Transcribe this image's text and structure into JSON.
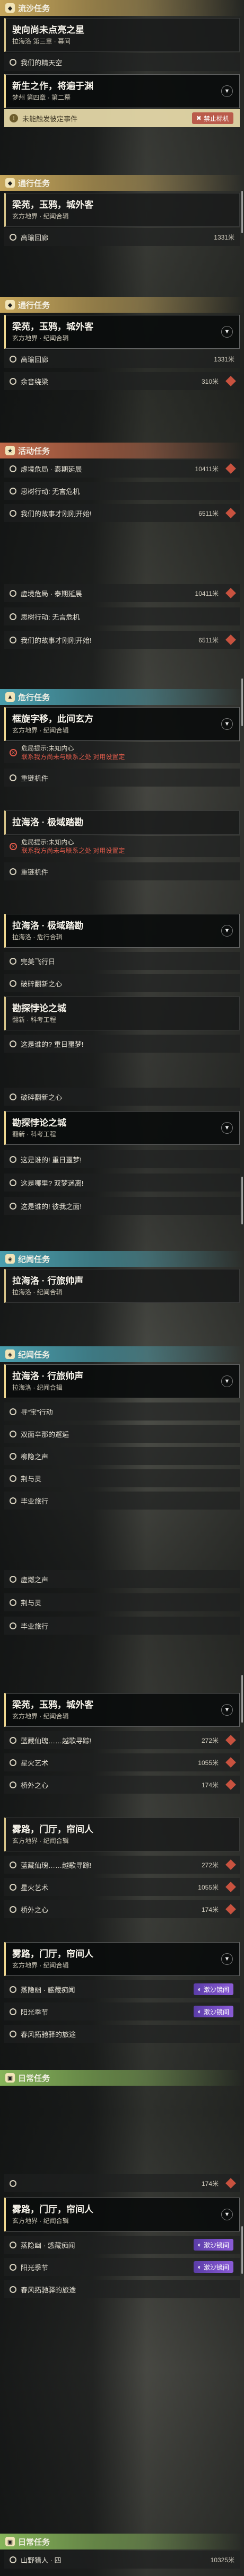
{
  "categories": {
    "main": "流沙任务",
    "main2": "通行任务",
    "activity": "活动任务",
    "hidden": "危行任务",
    "region": "纪闻任务",
    "daily": "日常任务"
  },
  "badges": {
    "locked": "禁止标机",
    "tracked": "漱沙镜间"
  },
  "s1": {
    "card1": {
      "title": "驶向尚未点亮之星",
      "sub": "拉海洛 第三章 · 幕间"
    },
    "row1": "我们的精天空",
    "card2": {
      "title": "新生之作，将遍于渊",
      "sub": "梦州 第四章 · 第二幕"
    },
    "banner": "未能触发彼定事件"
  },
  "s2": {
    "card": {
      "title": "梁苑，玉鸦，城外客",
      "sub": "玄方地界 · 纪闻合辑"
    },
    "row1": {
      "label": "高瑜回廊",
      "dist": "1331米"
    }
  },
  "s3": {
    "card": {
      "title": "梁苑，玉鸦，城外客",
      "sub": "玄方地界 · 纪闻合辑"
    },
    "row1": {
      "label": "高瑜回廊",
      "dist": "1331米"
    },
    "row2": {
      "label": "余音绕梁",
      "dist": "310米"
    }
  },
  "s4": {
    "rows": [
      {
        "label": "虚境危局 · 泰期延展",
        "dist": "10411米"
      },
      {
        "label": "思树行动: 无言危机",
        "dist": ""
      },
      {
        "label": "我们的故事才刚刚开始!",
        "dist": "6511米"
      }
    ]
  },
  "s5": {
    "rows": [
      {
        "label": "虚境危局 · 泰期延展",
        "dist": "10411米"
      },
      {
        "label": "思树行动: 无言危机",
        "dist": ""
      },
      {
        "label": "我们的故事才刚刚开始!",
        "dist": "6511米"
      }
    ]
  },
  "s6": {
    "card": {
      "title": "框旋字移，此间玄方",
      "sub": "玄方地界 · 纪闻合辑"
    },
    "red": {
      "line1": "危局提示:未知内心",
      "line2": "联系我方尚未与联系之处 对用设置定"
    },
    "row": "重链机件"
  },
  "s7": {
    "card": {
      "title": "拉海洛 · 极域踏勘",
      "sub": ""
    },
    "red": {
      "line1": "危局提示:未知内心",
      "line2": "联系我方尚未与联系之处 对用设置定"
    },
    "row": "重链机件"
  },
  "s8": {
    "card": {
      "title": "拉海洛 · 极域踏勘",
      "sub": "拉海洛 · 危行合辑"
    },
    "rows": [
      "完美飞行日",
      "破碎翻新之心"
    ],
    "card2": {
      "title": "勘探悖论之城",
      "sub": "翻新 · 科考工程"
    },
    "rows2": [
      "这是谁的? 重日噩梦!"
    ]
  },
  "s9": {
    "rows": [
      "破碎翻新之心"
    ],
    "card": {
      "title": "勘探悖论之城",
      "sub": "翻新 · 科考工程"
    },
    "rows2": [
      "这是谁的! 重日噩梦!",
      "这是哪里? 双梦迷离!",
      "这是谁的! 彼我之面!"
    ]
  },
  "s10": {
    "card": {
      "title": "拉海洛 · 行旅帅声",
      "sub": "拉海洛 · 纪闻合辑"
    }
  },
  "s11": {
    "card": {
      "title": "拉海洛 · 行旅帅声",
      "sub": "拉海洛 · 纪闻合辑"
    },
    "rows": [
      "寻“宝”行动",
      "双面辛那的邂逅",
      "柳隐之声",
      "荆与灵",
      "毕业旅行"
    ]
  },
  "s12": {
    "rows": [
      "虚燃之声",
      "荆与灵",
      "毕业旅行"
    ]
  },
  "s13": {
    "card": {
      "title": "梁苑，玉鸦，城外客",
      "sub": "玄方地界 · 纪闻合辑"
    },
    "rows": [
      {
        "label": "蓝藏仙瑰……越歌寻踪!",
        "dist": "272米"
      },
      {
        "label": "星火艺术",
        "dist": "1055米"
      },
      {
        "label": "桥外之心",
        "dist": "174米"
      }
    ]
  },
  "s14": {
    "card": {
      "title": "雾路，门厅，帘间人",
      "sub": "玄方地界 · 纪闻合辑"
    },
    "rows": [
      {
        "label": "蓝藏仙瑰……越歌寻踪!",
        "dist": "272米"
      },
      {
        "label": "星火艺术",
        "dist": "1055米"
      },
      {
        "label": "桥外之心",
        "dist": "174米"
      }
    ]
  },
  "s15": {
    "card": {
      "title": "雾路，门厅，帘间人",
      "sub": "玄方地界 · 纪闻合辑"
    },
    "rows": [
      "蒸隐幽 · 惑藏痴闻",
      "阳光季节",
      "春风拓驰驿的旅途"
    ]
  },
  "s16": {
    "rows": [
      {
        "label": "",
        "dist": "174米"
      }
    ],
    "card": {
      "title": "雾路，门厅，帘间人",
      "sub": "玄方地界 · 纪闻合辑"
    },
    "rows2": [
      "蒸隐幽 · 惑藏痴闻",
      "阳光季节",
      "春风拓驰驿的旅途"
    ]
  },
  "s17": {
    "rows": [
      {
        "label": "山野猎人 · 四",
        "dist": "10325米"
      }
    ]
  }
}
